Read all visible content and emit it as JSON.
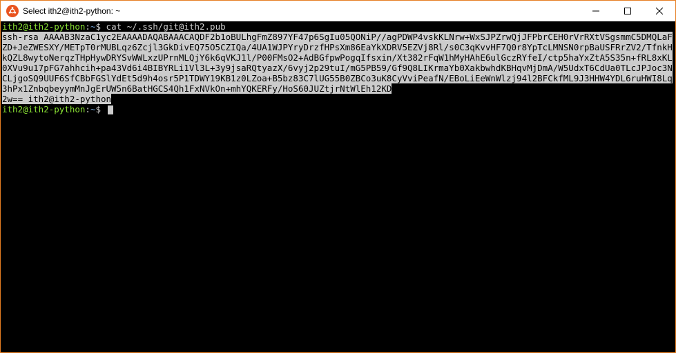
{
  "window": {
    "title": "Select ith2@ith2-python: ~"
  },
  "terminal": {
    "prompt_user_host": "ith2@ith2-python",
    "prompt_colon": ":",
    "prompt_path": "~",
    "prompt_symbol": "$",
    "command": "cat ~/.ssh/git@ith2.pub",
    "output_prefix": "ssh-rsa AAAAB3NzaC1yc2EAAAADAQABAAACAQDF2b1oBULhgFmZ897YF47p6SgIu05QONiP//agPDWP4vskKLNrw+WxSJPZrwQjJFPbrCEH0rVrRXtVSgsmmC5DMQLaFZD+JeZWESXY/METpT0rMUBLqz6Zcjl3GkDivEQ75O5CZIQa/4UA1WJPYryDrzfHPsXm86EaYkXDRV5EZVj8Rl/s0C3qKvvHF7Q0r8YpTcLMNSN0rpBaUSFRrZV2/TfnkHkQZL8wytoNerqzTHpHywDRYSvWWLxzUPrnMLQjY6k6qVKJ1l/P00FMsO2+AdBGfpwPogqIfsxin/Xt382rFqW1hMyHAhE6ulGczRYfeI/ctp5haYxZtA5S35n+fRL8xKL0XVu9u17pFG7ahhcih+pa43Vd6i4BIBYRLi1Vl3L+3y9jsaRQtyazX/6vyj2p29tuI/mG5PB59/Gf9Q8LIKrmaYb0XakbwhdKBHqvMjDmA/W5UdxT6CdUa0TLcJPJoc3NCLjgoSQ9UUF6SfCBbFGSlYdEt5d9h4osr5P1TDWY19KB1z0LZoa+B5bz83C7lUG55B0ZBCo3uK8CyVviPeafN/EBoLiEeWnWlzj94l2BFCkfML9J3HHW4YDL6ruHWI8Lq3hPx1ZnbqbeyymMnJgErUW5n6BatHGCS4Qh1FxNVkOn+mhYQKERFy/HoS60JUZtjrNtWlEh12KD",
    "output_suffix": "2w== ith2@ith2-python"
  }
}
